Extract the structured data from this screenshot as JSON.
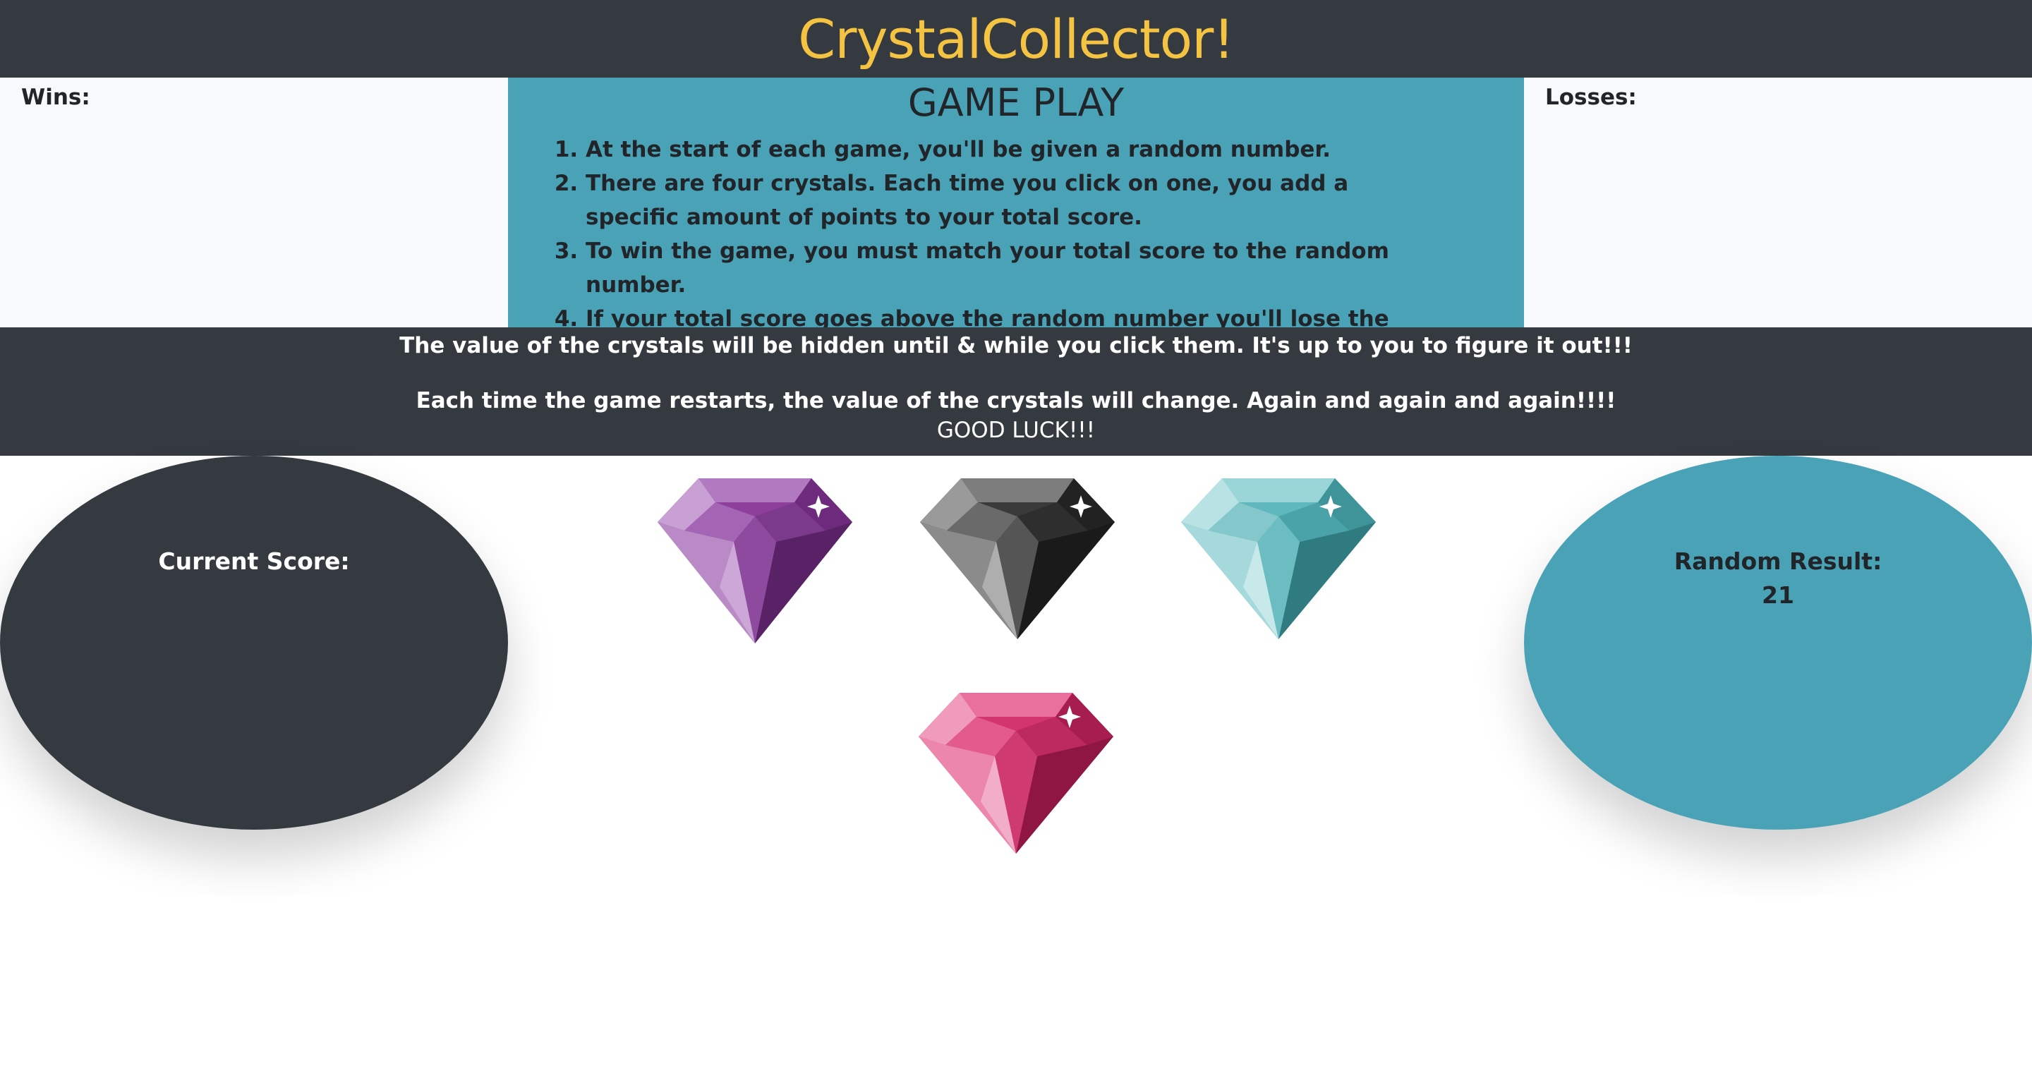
{
  "app": {
    "title": "CrystalCollector!"
  },
  "scoreboard": {
    "wins_label": "Wins:",
    "losses_label": "Losses:"
  },
  "gameplay": {
    "heading": "GAME PLAY",
    "rules": [
      "At the start of each game, you'll be given a random number.",
      "There are four crystals. Each time you click on one, you add a specific amount of points to your total score.",
      "To win the game, you must match your total score to the random number.",
      "If your total score goes above the random number you'll lose the game."
    ]
  },
  "notice": {
    "line1": "The value of the crystals will be hidden until & while you click them. It's up to you to figure it out!!!",
    "line2": "Each time the game restarts, the value of the crystals will change. Again and again and again!!!!",
    "line3": "GOOD LUCK!!!"
  },
  "score": {
    "label": "Current Score:",
    "value": ""
  },
  "random": {
    "label": "Random Result:",
    "value": "21"
  },
  "crystals": [
    {
      "name": "purple",
      "color": "#8e3f9c"
    },
    {
      "name": "black",
      "color": "#3a3a3a"
    },
    {
      "name": "teal",
      "color": "#5fb8bd"
    },
    {
      "name": "pink",
      "color": "#d3356f"
    }
  ],
  "colors": {
    "header_bg": "#343a40",
    "title": "#f5c342",
    "accent": "#4aa2b7",
    "panel": "#f8f9fa"
  }
}
